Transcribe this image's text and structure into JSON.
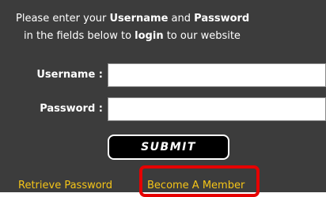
{
  "intro": {
    "line1_prefix": "Please enter your ",
    "line1_bold1": "Username",
    "line1_mid": " and ",
    "line1_bold2": "Password",
    "line2_prefix": "in the fields below to ",
    "line2_bold": "login",
    "line2_suffix": " to our website"
  },
  "form": {
    "username_label": "Username :",
    "username_value": "",
    "password_label": "Password :",
    "password_value": "",
    "submit_label": "SUBMIT"
  },
  "links": {
    "retrieve_password": "Retrieve Password",
    "become_member": "Become A Member"
  },
  "colors": {
    "panel_background": "#3c3c3c",
    "link_color": "#f5c518",
    "highlight_border": "#e60000"
  }
}
